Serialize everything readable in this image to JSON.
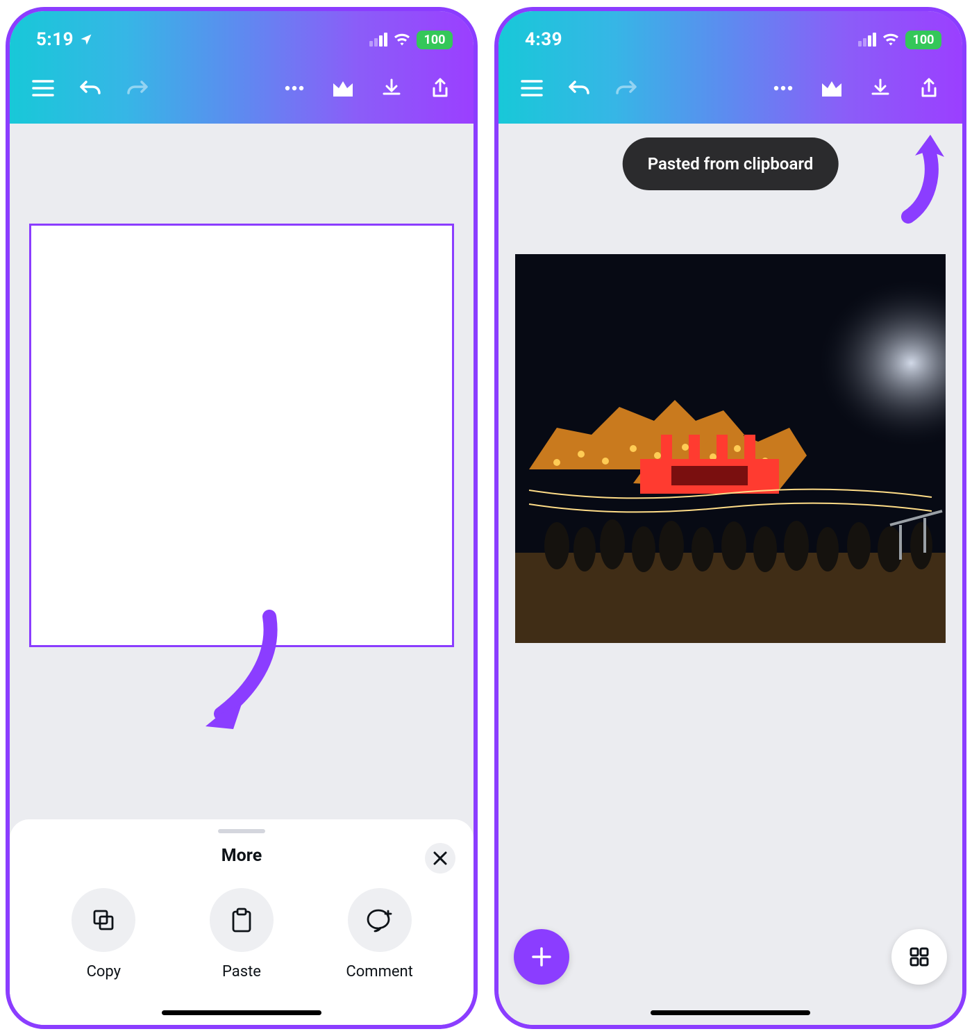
{
  "left": {
    "status": {
      "time": "5:19",
      "battery": "100",
      "location_on": true
    },
    "toolbar": {
      "icons": [
        "menu",
        "undo",
        "redo",
        "more",
        "crown",
        "download",
        "share"
      ]
    },
    "sheet": {
      "title": "More",
      "actions": [
        {
          "id": "copy",
          "label": "Copy"
        },
        {
          "id": "paste",
          "label": "Paste"
        },
        {
          "id": "comment",
          "label": "Comment"
        }
      ]
    },
    "annotation": {
      "target": "paste"
    }
  },
  "right": {
    "status": {
      "time": "4:39",
      "battery": "100"
    },
    "toolbar": {
      "icons": [
        "menu",
        "undo",
        "redo",
        "more",
        "crown",
        "download",
        "share"
      ]
    },
    "toast": "Pasted from clipboard",
    "annotation": {
      "target": "download"
    }
  }
}
